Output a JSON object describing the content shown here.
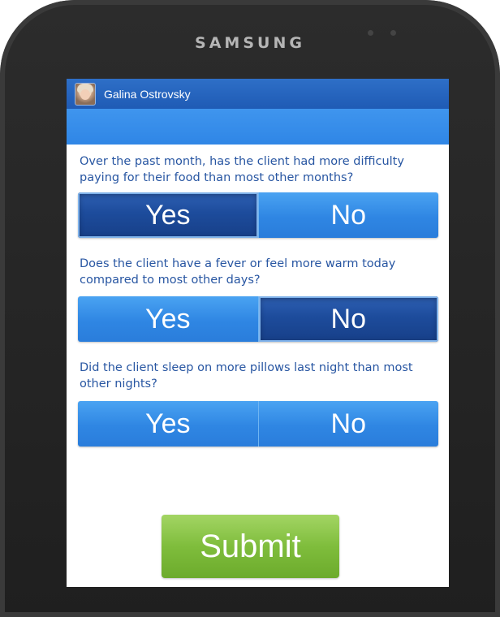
{
  "device": {
    "brand": "SAMSUNG"
  },
  "header": {
    "user_name": "Galina Ostrovsky",
    "avatar_icon": "user-photo"
  },
  "questions": [
    {
      "text": "Over the past month, has the client had more difficulty paying for their food than most other months?",
      "yes_label": "Yes",
      "no_label": "No",
      "selected": "Yes"
    },
    {
      "text": "Does the client have a fever or feel more warm today compared to most other days?",
      "yes_label": "Yes",
      "no_label": "No",
      "selected": "No"
    },
    {
      "text": "Did the client sleep on more pillows last night than most other nights?",
      "yes_label": "Yes",
      "no_label": "No",
      "selected": ""
    }
  ],
  "submit_label": "Submit",
  "colors": {
    "header": "#1f5bb5",
    "button_blue": "#2f86e3",
    "button_selected": "#1d4c9c",
    "submit_green": "#7fbd3c",
    "question_text": "#2856a2"
  }
}
